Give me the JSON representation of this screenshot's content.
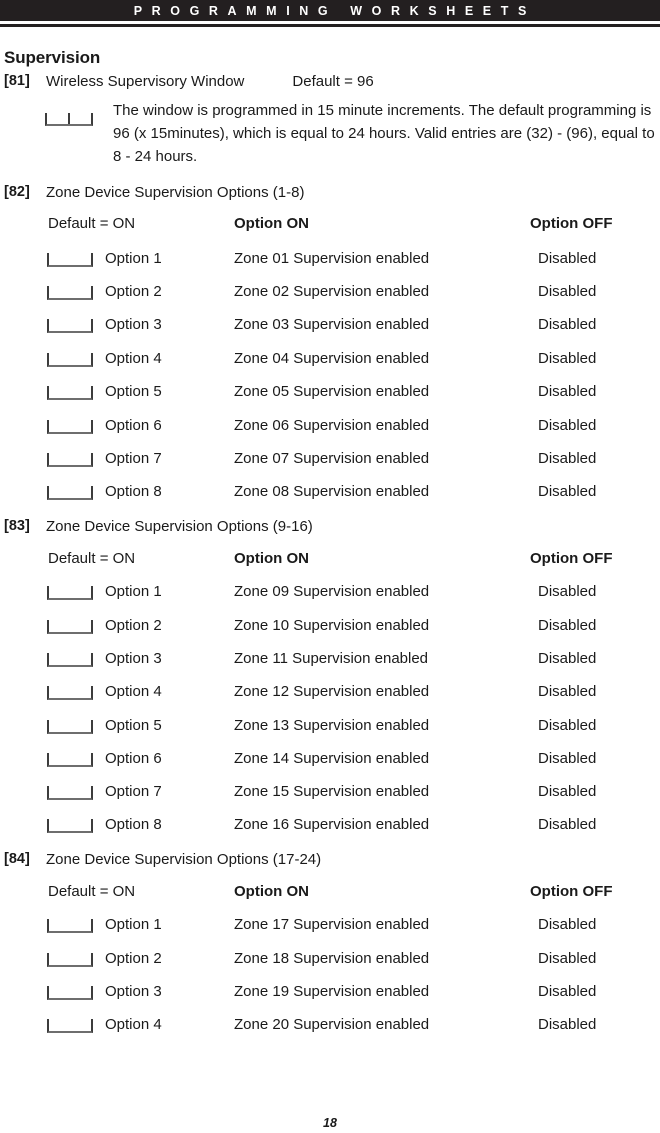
{
  "header": {
    "running_title": "PROGRAMMING WORKSHEETS"
  },
  "section": {
    "title": "Supervision"
  },
  "entries": [
    {
      "tag": "[81]",
      "title": "Wireless Supervisory Window",
      "default": "Default = 96",
      "note": "The window is programmed in 15 minute increments. The default programming is 96 (x 15minutes), which is equal to 24 hours. Valid entries are (32) - (96), equal to 8 - 24 hours.",
      "blank_field": "entry-blank-two-cell"
    },
    {
      "tag": "[82]",
      "title": "Zone Device Supervision Options (1-8)",
      "columns": {
        "default": "Default = ON",
        "on": "Option ON",
        "off": "Option OFF"
      },
      "rows": [
        {
          "option": "Option 1",
          "on": "Zone 01 Supervision enabled",
          "off": "Disabled"
        },
        {
          "option": "Option 2",
          "on": "Zone 02 Supervision enabled",
          "off": "Disabled"
        },
        {
          "option": "Option 3",
          "on": "Zone 03 Supervision enabled",
          "off": "Disabled"
        },
        {
          "option": "Option 4",
          "on": "Zone 04 Supervision enabled",
          "off": "Disabled"
        },
        {
          "option": "Option 5",
          "on": "Zone 05 Supervision enabled",
          "off": "Disabled"
        },
        {
          "option": "Option 6",
          "on": "Zone 06 Supervision enabled",
          "off": "Disabled"
        },
        {
          "option": "Option 7",
          "on": "Zone 07 Supervision enabled",
          "off": "Disabled"
        },
        {
          "option": "Option 8",
          "on": "Zone 08 Supervision enabled",
          "off": "Disabled"
        }
      ]
    },
    {
      "tag": "[83]",
      "title": "Zone Device Supervision Options (9-16)",
      "columns": {
        "default": "Default = ON",
        "on": "Option ON",
        "off": "Option OFF"
      },
      "rows": [
        {
          "option": "Option 1",
          "on": "Zone 09 Supervision enabled",
          "off": "Disabled"
        },
        {
          "option": "Option 2",
          "on": "Zone 10 Supervision enabled",
          "off": "Disabled"
        },
        {
          "option": "Option 3",
          "on": "Zone 11 Supervision enabled",
          "off": "Disabled"
        },
        {
          "option": "Option 4",
          "on": "Zone 12 Supervision enabled",
          "off": "Disabled"
        },
        {
          "option": "Option 5",
          "on": "Zone 13 Supervision enabled",
          "off": "Disabled"
        },
        {
          "option": "Option 6",
          "on": "Zone 14 Supervision enabled",
          "off": "Disabled"
        },
        {
          "option": "Option 7",
          "on": "Zone 15 Supervision enabled",
          "off": "Disabled"
        },
        {
          "option": "Option 8",
          "on": "Zone 16 Supervision enabled",
          "off": "Disabled"
        }
      ]
    },
    {
      "tag": "[84]",
      "title": "Zone Device Supervision Options (17-24)",
      "columns": {
        "default": "Default = ON",
        "on": "Option ON",
        "off": "Option OFF"
      },
      "rows": [
        {
          "option": "Option 1",
          "on": "Zone 17 Supervision enabled",
          "off": "Disabled"
        },
        {
          "option": "Option 2",
          "on": "Zone 18 Supervision enabled",
          "off": "Disabled"
        },
        {
          "option": "Option 3",
          "on": "Zone 19 Supervision enabled",
          "off": "Disabled"
        },
        {
          "option": "Option 4",
          "on": "Zone 20 Supervision enabled",
          "off": "Disabled"
        }
      ]
    }
  ],
  "footer": {
    "page_number": "18"
  },
  "colors": {
    "header_bar": "#231f20",
    "text": "#1a1a1a",
    "blank_field_line": "#3c3c3c",
    "page_background": "#ffffff"
  }
}
